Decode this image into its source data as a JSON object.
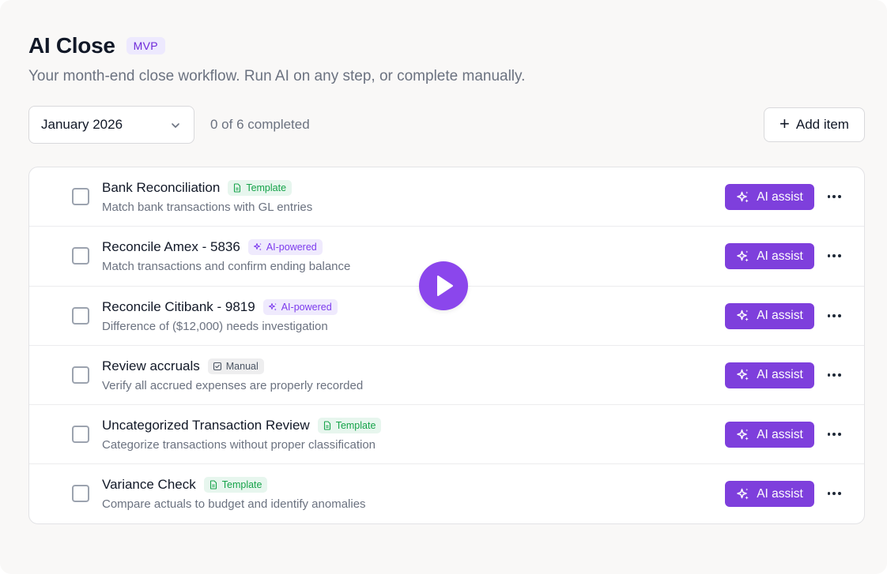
{
  "page": {
    "title": "AI Close",
    "badge": "MVP",
    "subtitle": "Your month-end close workflow. Run AI on any step, or complete manually."
  },
  "toolbar": {
    "period": "January 2026",
    "progress": "0 of 6 completed",
    "add_label": "Add item"
  },
  "ai_button_label": "AI assist",
  "colors": {
    "accent": "#7e3fdc",
    "template": "#16a34a",
    "ai_badge": "#7c3aed"
  },
  "items": [
    {
      "title": "Bank Reconciliation",
      "badge": "Template",
      "badge_type": "template",
      "description": "Match bank transactions with GL entries",
      "checked": false
    },
    {
      "title": "Reconcile Amex - 5836",
      "badge": "AI-powered",
      "badge_type": "ai",
      "description": "Match transactions and confirm ending balance",
      "checked": false
    },
    {
      "title": "Reconcile Citibank - 9819",
      "badge": "AI-powered",
      "badge_type": "ai",
      "description": "Difference of ($12,000) needs investigation",
      "checked": false
    },
    {
      "title": "Review accruals",
      "badge": "Manual",
      "badge_type": "manual",
      "description": "Verify all accrued expenses are properly recorded",
      "checked": false
    },
    {
      "title": "Uncategorized Transaction Review",
      "badge": "Template",
      "badge_type": "template",
      "description": "Categorize transactions without proper classification",
      "checked": false
    },
    {
      "title": "Variance Check",
      "badge": "Template",
      "badge_type": "template",
      "description": "Compare actuals to budget and identify anomalies",
      "checked": false
    }
  ],
  "icons": {
    "template": "document-icon",
    "ai": "sparkles-icon",
    "manual": "check-square-icon",
    "play": "play-icon"
  }
}
